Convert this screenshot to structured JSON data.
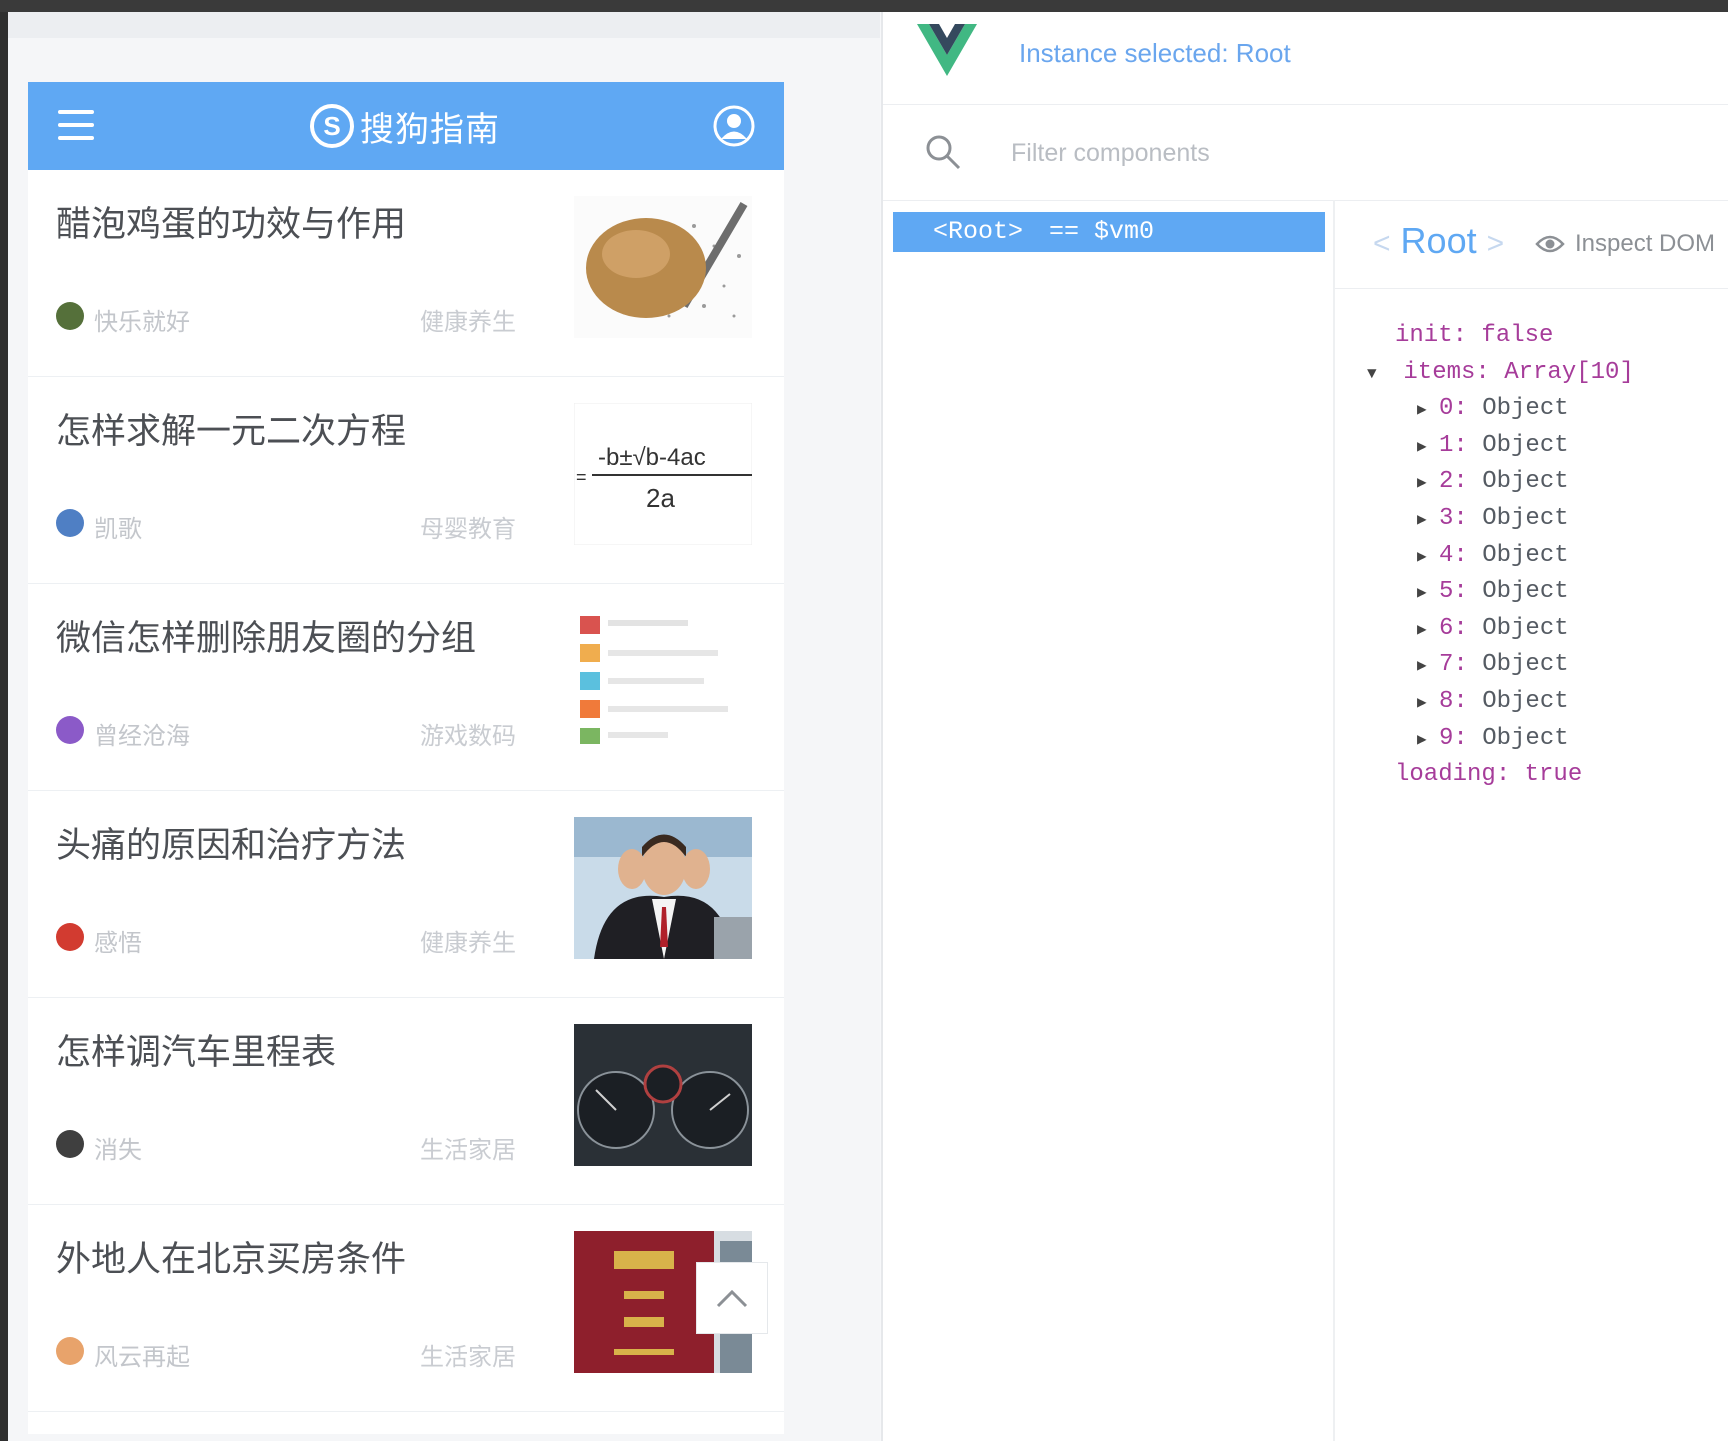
{
  "brand": {
    "name": "搜狗指南",
    "logo_letter": "S",
    "header_color": "#5fa8f3"
  },
  "feed": [
    {
      "title": "醋泡鸡蛋的功效与作用",
      "author": "快乐就好",
      "category": "健康养生",
      "avatar_color": "#55703a",
      "thumb": "egg"
    },
    {
      "title": "怎样求解一元二次方程",
      "author": "凯歌",
      "category": "母婴教育",
      "avatar_color": "#4f7fc4",
      "thumb": "formula",
      "formula_top": "-b±√b-4ac",
      "formula_bottom": "2a"
    },
    {
      "title": "微信怎样删除朋友圈的分组",
      "author": "曾经沧海",
      "category": "游戏数码",
      "avatar_color": "#8b5ac8",
      "thumb": "list"
    },
    {
      "title": "头痛的原因和治疗方法",
      "author": "感悟",
      "category": "健康养生",
      "avatar_color": "#d23b30",
      "thumb": "man"
    },
    {
      "title": "怎样调汽车里程表",
      "author": "消失",
      "category": "生活家居",
      "avatar_color": "#3f3f3f",
      "thumb": "dash"
    },
    {
      "title": "外地人在北京买房条件",
      "author": "风云再起",
      "category": "生活家居",
      "avatar_color": "#e8a36b",
      "thumb": "book"
    }
  ],
  "devtools": {
    "instance_label": "Instance selected: Root",
    "filter_placeholder": "Filter components",
    "root_tag": "<Root>",
    "root_var": "== $vm0",
    "selected_name": "Root",
    "bracket_open": "<",
    "bracket_close": ">",
    "inspect_dom": "Inspect DOM",
    "state": {
      "row1": "init: false",
      "row2": "items: Array[10]",
      "items": [
        {
          "index": "0:",
          "value": "Object"
        },
        {
          "index": "1:",
          "value": "Object"
        },
        {
          "index": "2:",
          "value": "Object"
        },
        {
          "index": "3:",
          "value": "Object"
        },
        {
          "index": "4:",
          "value": "Object"
        },
        {
          "index": "5:",
          "value": "Object"
        },
        {
          "index": "6:",
          "value": "Object"
        },
        {
          "index": "7:",
          "value": "Object"
        },
        {
          "index": "8:",
          "value": "Object"
        },
        {
          "index": "9:",
          "value": "Object"
        }
      ],
      "row_last": "loading: true"
    },
    "accent": "#5fa8f3",
    "vue_green": "#41b883",
    "vue_dark": "#35495e"
  }
}
